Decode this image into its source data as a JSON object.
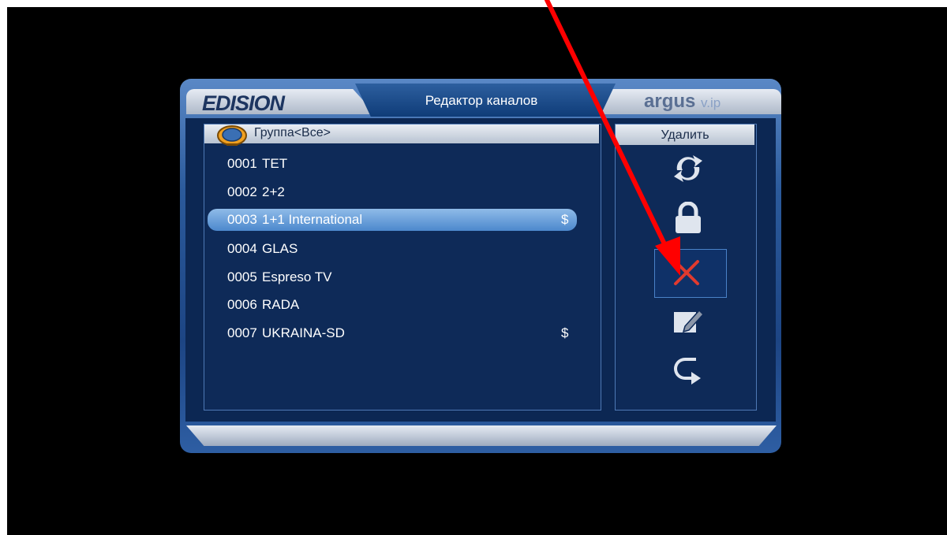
{
  "header": {
    "brand_left": "EDISION",
    "title": "Редактор каналов",
    "brand_right": "argus",
    "brand_right_suffix": "v.ip"
  },
  "group": {
    "label": "Группа<Все>"
  },
  "channels": [
    {
      "number": "0001",
      "name": "TET",
      "scrambled": ""
    },
    {
      "number": "0002",
      "name": "2+2",
      "scrambled": ""
    },
    {
      "number": "0003",
      "name": "1+1 International",
      "scrambled": "$"
    },
    {
      "number": "0004",
      "name": "GLAS",
      "scrambled": ""
    },
    {
      "number": "0005",
      "name": "Espreso TV",
      "scrambled": ""
    },
    {
      "number": "0006",
      "name": "RADA",
      "scrambled": ""
    },
    {
      "number": "0007",
      "name": "UKRAINA-SD",
      "scrambled": "$"
    }
  ],
  "selected_channel_index": 2,
  "actions": {
    "header": "Удалить",
    "items": [
      {
        "icon": "move-icon"
      },
      {
        "icon": "lock-icon"
      },
      {
        "icon": "delete-icon",
        "selected": true
      },
      {
        "icon": "rename-icon"
      },
      {
        "icon": "back-icon"
      }
    ]
  },
  "colors": {
    "frame": "#2b5a9b",
    "panel": "#0e2a58",
    "highlight": "#6fa4dc",
    "annotation_arrow": "#ff0000",
    "delete_x": "#e03a2e"
  }
}
